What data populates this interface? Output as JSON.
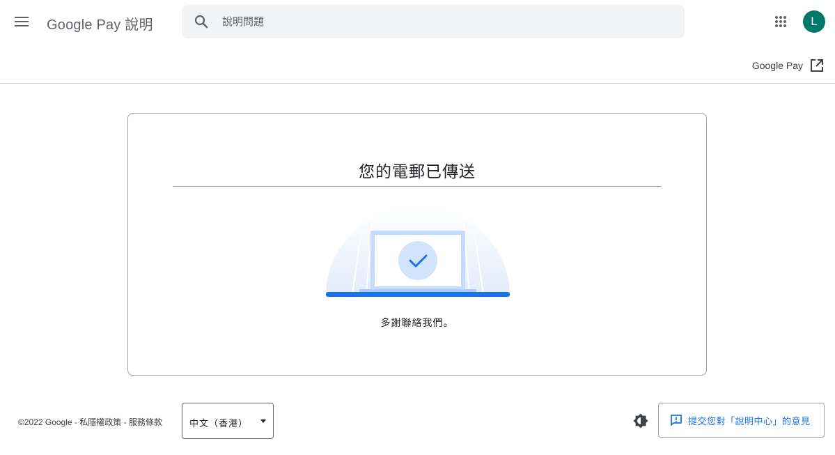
{
  "header": {
    "brand": "Google Pay 說明",
    "search_placeholder": "說明問題",
    "avatar_initial": "L",
    "avatar_color": "#00796b",
    "icons": {
      "menu": "hamburger-menu-icon",
      "search": "search-icon",
      "apps": "apps-grid-icon"
    }
  },
  "subheader": {
    "product_link_label": "Google Pay",
    "product_link_icon": "open-in-new-icon"
  },
  "card": {
    "title": "您的電郵已傳送",
    "message": "多謝聯絡我們。",
    "illustration_icon": "laptop-checkmark-icon"
  },
  "footer": {
    "copyright": "©2022 Google",
    "separator": " - ",
    "privacy_label": "私隱權政策",
    "terms_label": "服務條款",
    "language_value": "中文（香港）",
    "theme_icon": "brightness-icon",
    "feedback_label": "提交您對「說明中心」的意見",
    "feedback_icon": "feedback-icon"
  },
  "colors": {
    "accent": "#1a73e8",
    "avatar": "#00796b",
    "text_secondary": "#5f6368",
    "search_bg": "#f1f3f4"
  }
}
